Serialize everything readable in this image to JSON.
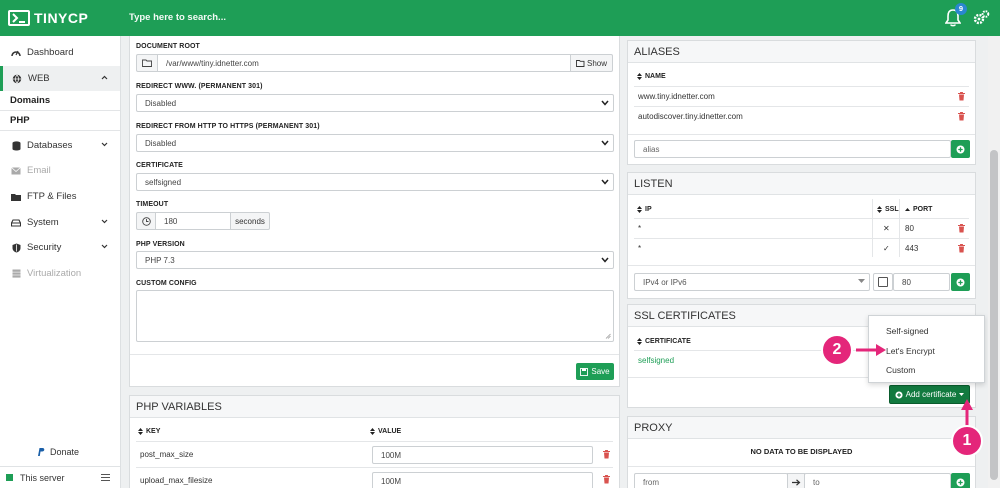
{
  "app": {
    "logo_text": "TINYCP",
    "search_placeholder": "Type here to search...",
    "notifications_count": "9"
  },
  "sidebar": {
    "items": [
      {
        "label": "Dashboard",
        "icon": "dashboard-icon"
      },
      {
        "label": "WEB",
        "icon": "globe-icon"
      },
      {
        "label": "Databases",
        "icon": "database-icon"
      },
      {
        "label": "Email",
        "icon": "envelope-icon"
      },
      {
        "label": "FTP & Files",
        "icon": "folder-icon"
      },
      {
        "label": "System",
        "icon": "drive-icon"
      },
      {
        "label": "Security",
        "icon": "shield-icon"
      },
      {
        "label": "Virtualization",
        "icon": "server-icon"
      }
    ],
    "web_sub": [
      "Domains",
      "PHP"
    ],
    "donate_label": "Donate",
    "server_label": "This server",
    "colors": {
      "accent": "#1e9e56",
      "muted": "#aaaaaa"
    }
  },
  "settings": {
    "document_root_label": "DOCUMENT ROOT",
    "document_root_value": "/var/www/tiny.idnetter.com",
    "show_label": "Show",
    "redirect_www_label": "REDIRECT WWW. (PERMANENT 301)",
    "redirect_www_value": "Disabled",
    "redirect_https_label": "REDIRECT FROM HTTP TO HTTPS (PERMANENT 301)",
    "redirect_https_value": "Disabled",
    "certificate_label": "CERTIFICATE",
    "certificate_value": "selfsigned",
    "timeout_label": "TIMEOUT",
    "timeout_value": "180",
    "timeout_unit": "seconds",
    "php_version_label": "PHP VERSION",
    "php_version_value": "PHP 7.3",
    "custom_config_label": "CUSTOM CONFIG",
    "save_label": "Save"
  },
  "php_variables": {
    "title": "PHP VARIABLES",
    "col_key": "KEY",
    "col_value": "VALUE",
    "rows": [
      {
        "key": "post_max_size",
        "value": "100M"
      },
      {
        "key": "upload_max_filesize",
        "value": "100M"
      }
    ]
  },
  "aliases": {
    "title": "ALIASES",
    "col_name": "NAME",
    "rows": [
      "www.tiny.idnetter.com",
      "autodiscover.tiny.idnetter.com"
    ],
    "input_placeholder": "alias"
  },
  "listen": {
    "title": "LISTEN",
    "col_ip": "IP",
    "col_ssl": "SSL",
    "col_port": "PORT",
    "rows": [
      {
        "ip": "*",
        "ssl": "✕",
        "port": "80"
      },
      {
        "ip": "*",
        "ssl": "✓",
        "port": "443"
      }
    ],
    "ip_select": "IPv4 or IPv6",
    "port_value": "80"
  },
  "ssl": {
    "title": "SSL CERTIFICATES",
    "col_certificate": "CERTIFICATE",
    "rows": [
      "selfsigned"
    ],
    "add_label": "Add certificate",
    "menu": [
      "Self-signed",
      "Let's Encrypt",
      "Custom"
    ]
  },
  "proxy": {
    "title": "PROXY",
    "empty": "NO DATA TO BE DISPLAYED",
    "from_placeholder": "from",
    "to_placeholder": "to"
  },
  "annotations": {
    "one": "1",
    "two": "2",
    "color": "#e4267a"
  }
}
